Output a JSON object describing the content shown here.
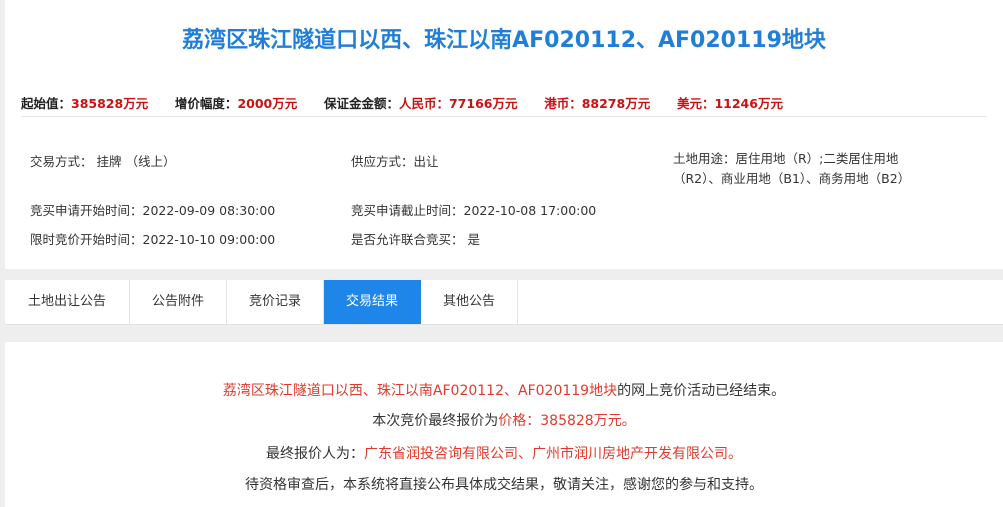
{
  "land": {
    "title": "荔湾区珠江隧道口以西、珠江以南AF020112、AF020119地块"
  },
  "price": {
    "start_label": "起始值：",
    "start_value": "385828万元",
    "increment_label": "增价幅度：",
    "increment_value": "2000万元",
    "deposit_label": "保证金金额：",
    "rmb_label": "人民币：",
    "rmb_value": "77166万元",
    "hkd_label": "港币：",
    "hkd_value": "88278万元",
    "usd_label": "美元：",
    "usd_value": "11246万元"
  },
  "info": {
    "trade_mode": "交易方式：  挂牌 （线上）",
    "supply_mode": "供应方式：出让",
    "land_use": "土地用途：居住用地（R）;二类居住用地（R2）、商业用地（B1）、商务用地（B2）",
    "apply_start": "竞买申请开始时间：2022-09-09 08:30:00",
    "apply_end": "竞买申请截止时间：2022-10-08 17:00:00",
    "bid_start": "限时竞价开始时间：2022-10-10 09:00:00",
    "joint_bid": "是否允许联合竞买：  是"
  },
  "tabs": [
    {
      "label": "土地出让公告"
    },
    {
      "label": "公告附件"
    },
    {
      "label": "竞价记录"
    },
    {
      "label": "交易结果"
    },
    {
      "label": "其他公告"
    }
  ],
  "result": {
    "line1_red": "荔湾区珠江隧道口以西、珠江以南AF020112、AF020119地块",
    "line1_tail": "的网上竞价活动已经结束。",
    "line2_head": "本次竞价最终报价为",
    "line2_red": "价格：385828万元。",
    "line3_head": "最终报价人为：",
    "line3_red": "广东省润投咨询有限公司、广州市润川房地产开发有限公司。",
    "line4": "待资格审查后，本系统将直接公布具体成交结果，敬请关注，感谢您的参与和支持。"
  },
  "colors": {
    "title_blue": "#1f7fd8",
    "tab_active": "#1e86e8",
    "value_red": "#cc1111",
    "result_red": "#e23a2a"
  }
}
